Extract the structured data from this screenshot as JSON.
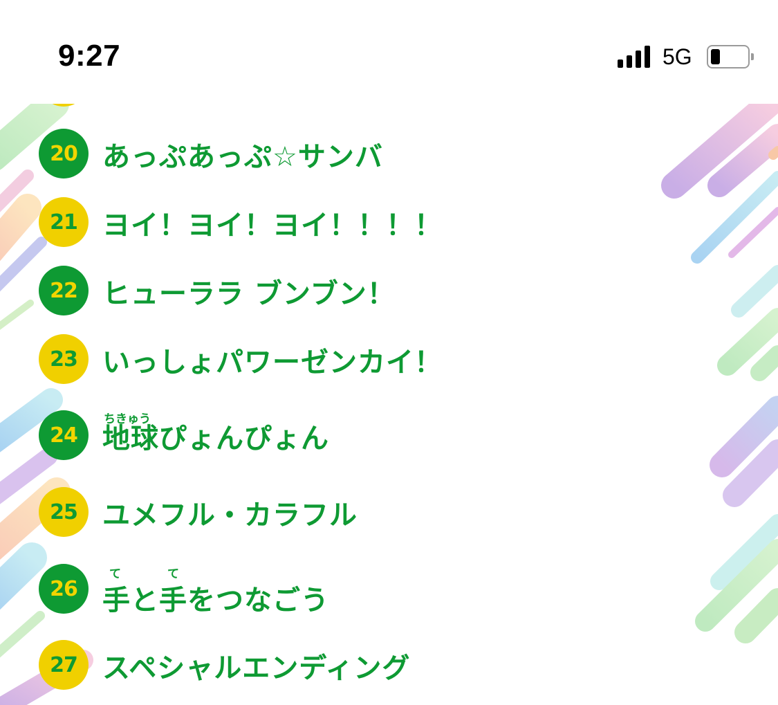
{
  "status_bar": {
    "time": "9:27",
    "network": "5G",
    "icons": [
      "signal-icon",
      "battery-icon"
    ]
  },
  "colors": {
    "title_green": "#0e9a33",
    "badge_green": "#0e9a33",
    "badge_yellow": "#f0d000"
  },
  "songs": [
    {
      "number": "20",
      "title": "あっぷあっぷ☆サンバ",
      "badge": "green"
    },
    {
      "number": "21",
      "title": "ヨイ！ヨイ！ヨイ！！！！",
      "badge": "yellow"
    },
    {
      "number": "22",
      "title": "ヒューララ ブンブン！",
      "badge": "green"
    },
    {
      "number": "23",
      "title": "いっしょパワーゼンカイ！",
      "badge": "yellow"
    },
    {
      "number": "24",
      "title": "地球ぴょんぴょん",
      "ruby": "ちきゅう",
      "badge": "green"
    },
    {
      "number": "25",
      "title": "ユメフル・カラフル",
      "badge": "yellow"
    },
    {
      "number": "26",
      "title": "手と手をつなごう",
      "ruby_1": "て",
      "ruby_2": "て",
      "badge": "green"
    },
    {
      "number": "27",
      "title": "スペシャルエンディング",
      "badge": "yellow"
    }
  ]
}
